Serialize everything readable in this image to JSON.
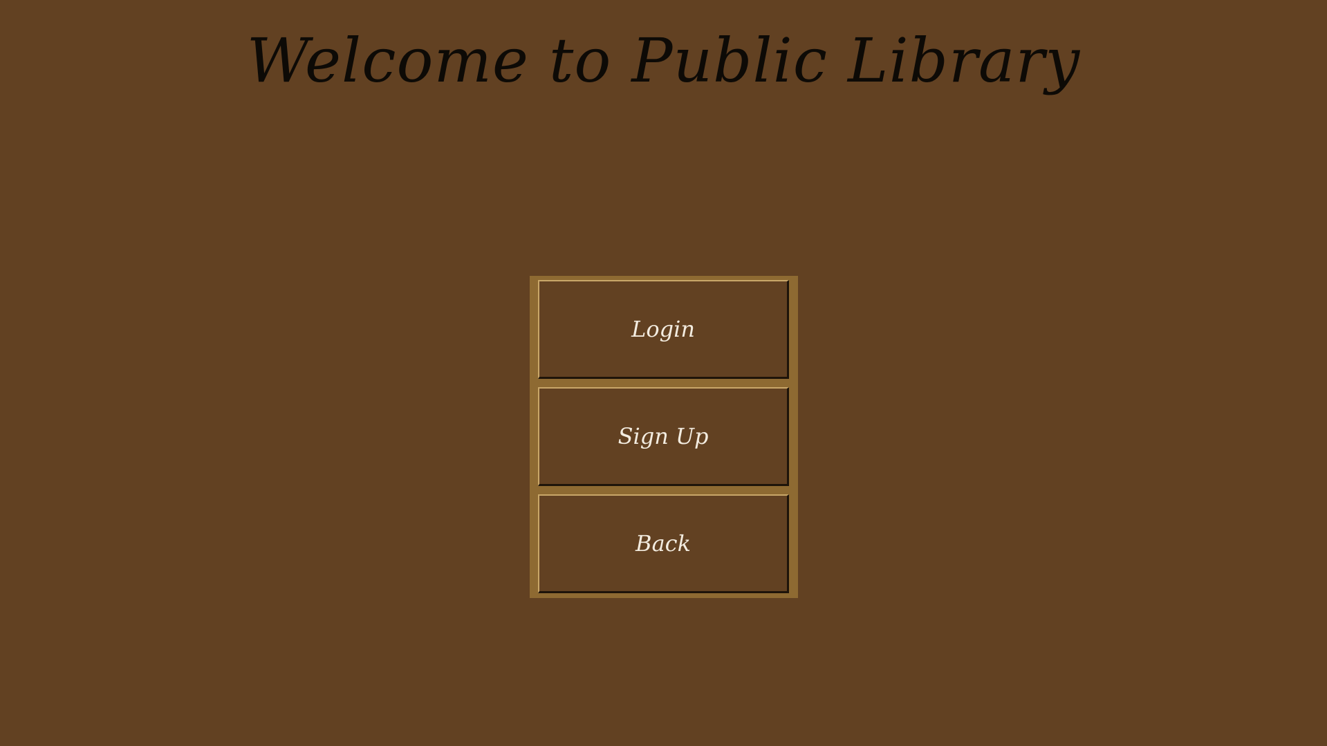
{
  "header": {
    "title": "Welcome to Public Library"
  },
  "menu": {
    "login_label": "Login",
    "signup_label": "Sign Up",
    "back_label": "Back"
  },
  "colors": {
    "background": "#624122",
    "panel": "#8e6a32",
    "button_text": "#f3ece0",
    "title_text": "#0d0a06"
  }
}
